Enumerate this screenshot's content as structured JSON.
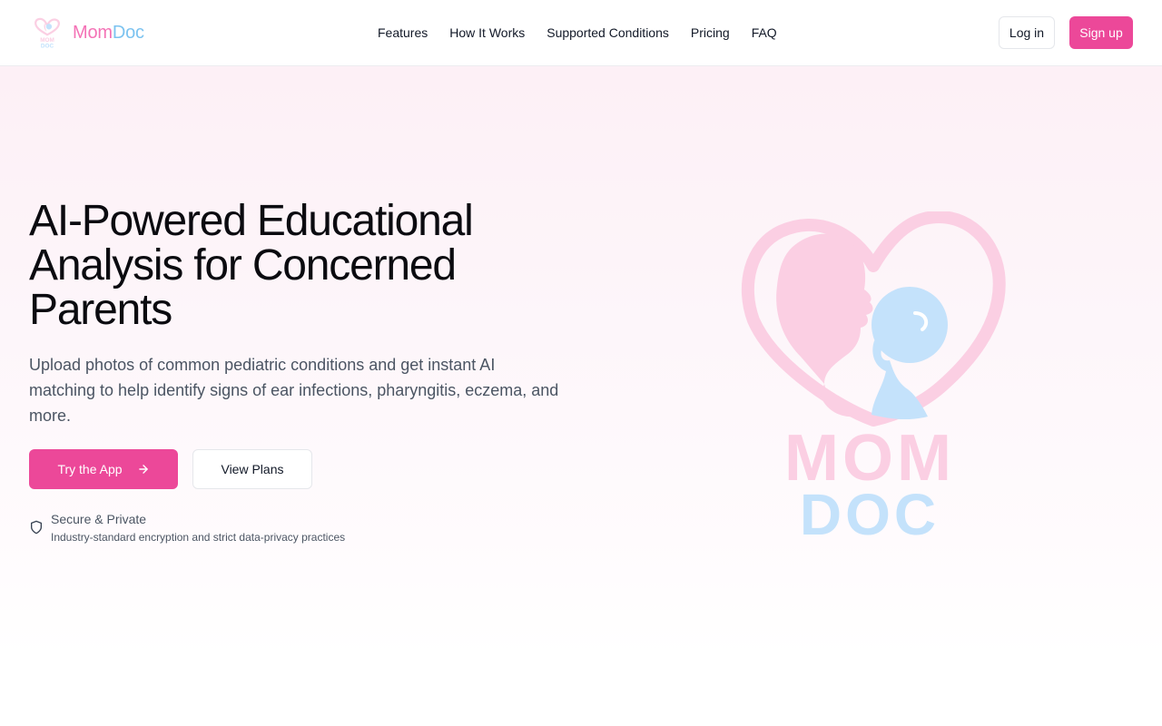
{
  "header": {
    "brand": {
      "part1": "Mom",
      "part2": "Doc"
    },
    "nav": [
      {
        "label": "Features"
      },
      {
        "label": "How It Works"
      },
      {
        "label": "Supported Conditions"
      },
      {
        "label": "Pricing"
      },
      {
        "label": "FAQ"
      }
    ],
    "login_label": "Log in",
    "signup_label": "Sign up"
  },
  "hero": {
    "title": "AI-Powered Educational Analysis for Concerned Parents",
    "subtitle": "Upload photos of common pediatric conditions and get instant AI matching to help identify signs of ear infections, pharyngitis, eczema, and more.",
    "primary_cta": "Try the App",
    "secondary_cta": "View Plans",
    "secure_title": "Secure & Private",
    "secure_desc": "Industry-standard encryption and strict data-privacy practices",
    "logo_text_line1": "MOM",
    "logo_text_line2": "DOC"
  },
  "icons": {
    "arrow": "arrow-right-icon",
    "shield": "shield-icon"
  },
  "colors": {
    "brand_pink": "#ec4899",
    "logo_pink": "#fbcfe3",
    "logo_blue": "#c4e2fb",
    "brand_name_pink": "#f472b6",
    "brand_name_blue": "#7cc3f0",
    "hero_bg": "#fdf0f6"
  }
}
